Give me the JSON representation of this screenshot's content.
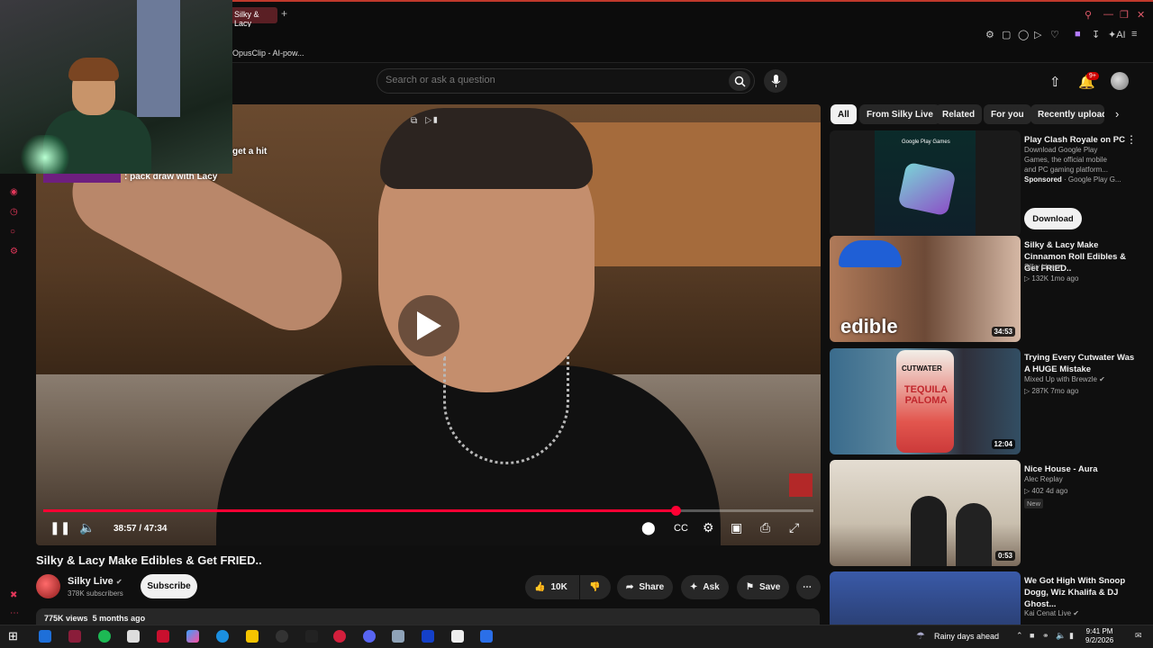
{
  "browser": {
    "tab_title": "Silky & Lacy Make E",
    "new_tab": "+",
    "bookmark": "OpusClip - AI-pow..."
  },
  "header": {
    "search_placeholder": "Search or ask a question",
    "notifications_badge": "9+"
  },
  "video": {
    "chat_line_1": "get a hit",
    "chat_line_2": ": pack draw with Lacy",
    "time": "38:57 / 47:34",
    "progress_fraction": 0.821,
    "title": "Silky & Lacy Make Edibles & Get FRIED..",
    "channel": "Silky Live",
    "subscribers": "378K subscribers",
    "subscribe_label": "Subscribe",
    "likes": "10K",
    "share_label": "Share",
    "ask_label": "Ask",
    "save_label": "Save",
    "views": "775K views",
    "age": "5 months ago"
  },
  "chips": [
    "All",
    "From Silky Live",
    "Related",
    "For you",
    "Recently uploaded"
  ],
  "recommendations": [
    {
      "title": "Play Clash Royale on PC",
      "desc": "Download Google Play Games, the official mobile and PC gaming platform...",
      "sponsored": "Sponsored",
      "advertiser": "Google Play G...",
      "button": "Download",
      "thumb_label": "Google Play Games"
    },
    {
      "title": "Silky & Lacy Make Cinnamon Roll Edibles & Get FRIED..",
      "channel": "Silky Live",
      "meta": "132K  1mo ago",
      "duration": "34:53",
      "thumb_text": "edible"
    },
    {
      "title": "Trying Every Cutwater Was A HUGE Mistake",
      "channel": "Mixed Up with Brewzle",
      "meta": "287K  7mo ago",
      "duration": "12:04",
      "thumb_text": "TEQUILA PALOMA",
      "thumb_brand": "CUTWATER"
    },
    {
      "title": "Nice House - Aura",
      "channel": "Alec Replay",
      "meta": "402  4d ago",
      "badge": "New",
      "duration": "0:53"
    },
    {
      "title": "We Got High With Snoop Dogg, Wiz Khalifa & DJ Ghost...",
      "channel": "Kai Cenat Live"
    }
  ],
  "taskbar": {
    "weather": "Rainy days ahead",
    "time": "9:41 PM",
    "date": "9/2/2026"
  },
  "colors": {
    "accent": "#ff0033",
    "background": "#0f0f0f",
    "pill": "#272727"
  }
}
